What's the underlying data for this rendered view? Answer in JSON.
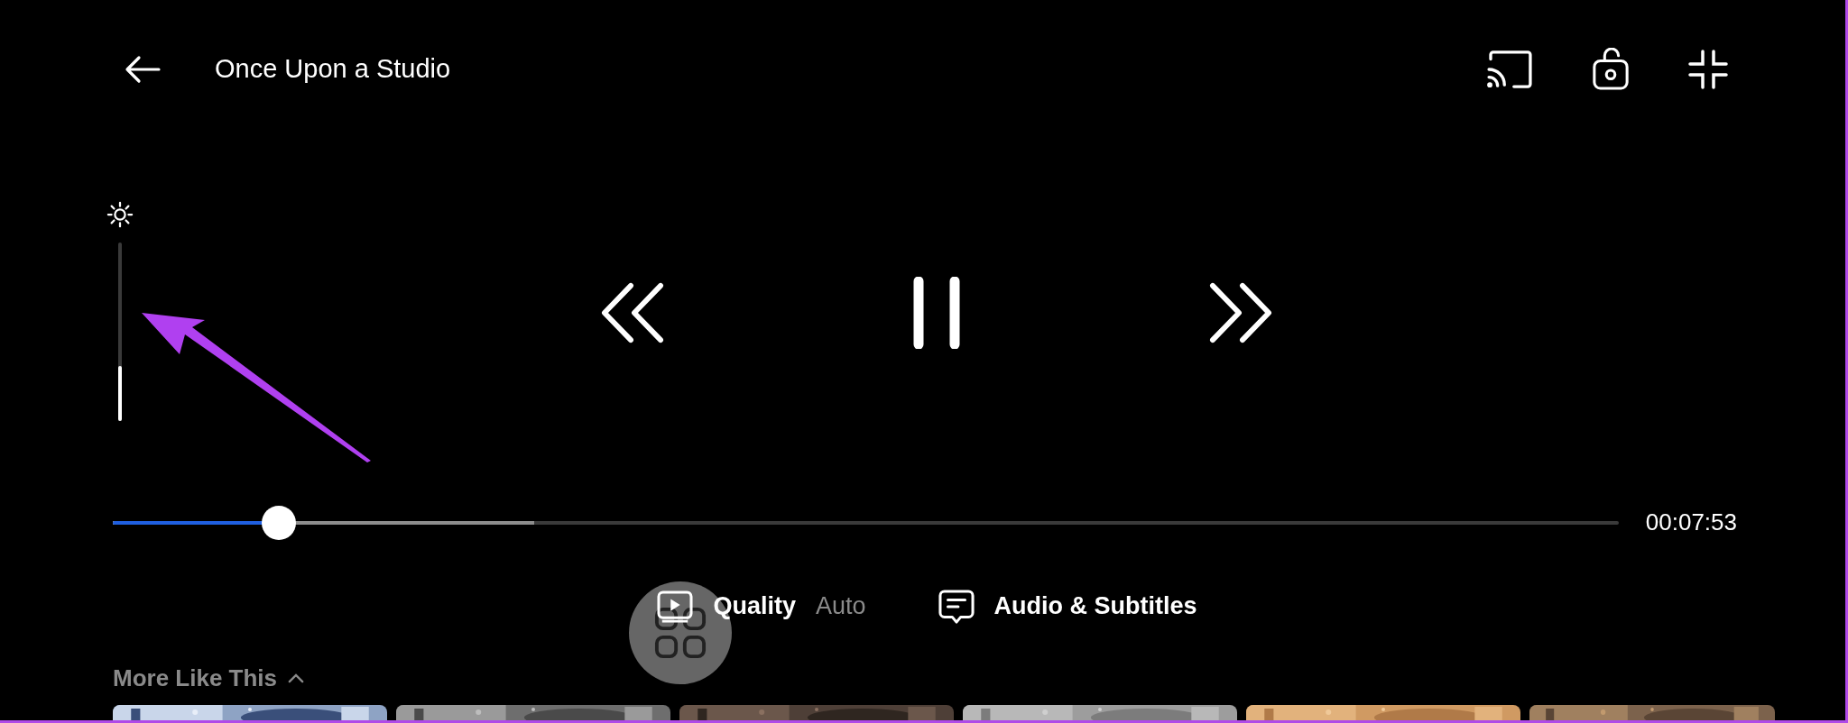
{
  "header": {
    "title": "Once Upon a Studio"
  },
  "brightness": {
    "level": 0.31
  },
  "seek_bar": {
    "level": 0.11,
    "buffered": {
      "level": 0.28
    },
    "time": "00:07:53"
  },
  "options": [
    {
      "kind": "quality",
      "label": "Quality",
      "value": "Auto"
    },
    {
      "kind": "audio",
      "label": "Audio & Subtitles"
    }
  ],
  "more_like_this": {
    "title": "More Like This",
    "expanded": true
  }
}
